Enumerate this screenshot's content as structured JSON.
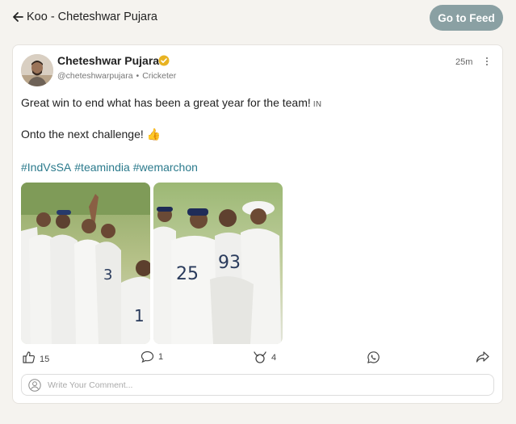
{
  "header": {
    "title": "Koo - Cheteshwar Pujara",
    "back_icon": "arrow-left-icon",
    "go_to_feed_label": "Go to Feed"
  },
  "post": {
    "author": {
      "name": "Cheteshwar Pujara",
      "verified_icon": "verified-badge-icon",
      "handle": "@cheteshwarpujara",
      "separator": "•",
      "role": "Cricketer"
    },
    "time": "25m",
    "text_line1": "Great win to end what has been a great year for the team!",
    "language_tag": "IN",
    "text_line2": "Onto the next challenge! 👍",
    "hashtags": [
      "#IndVsSA",
      "#teamindia",
      "#wemarchon"
    ],
    "images": [
      {
        "description": "team-celebration-photo-1"
      },
      {
        "description": "team-celebration-photo-2"
      }
    ],
    "actions": {
      "like_count": "15",
      "comment_count": "1",
      "rekoo_count": "4"
    }
  },
  "comment": {
    "placeholder": "Write Your Comment..."
  },
  "colors": {
    "background": "#f5f3ef",
    "feed_button": "#8aa0a3",
    "hashtag": "#2b7a8c",
    "verified": "#e8b322"
  }
}
